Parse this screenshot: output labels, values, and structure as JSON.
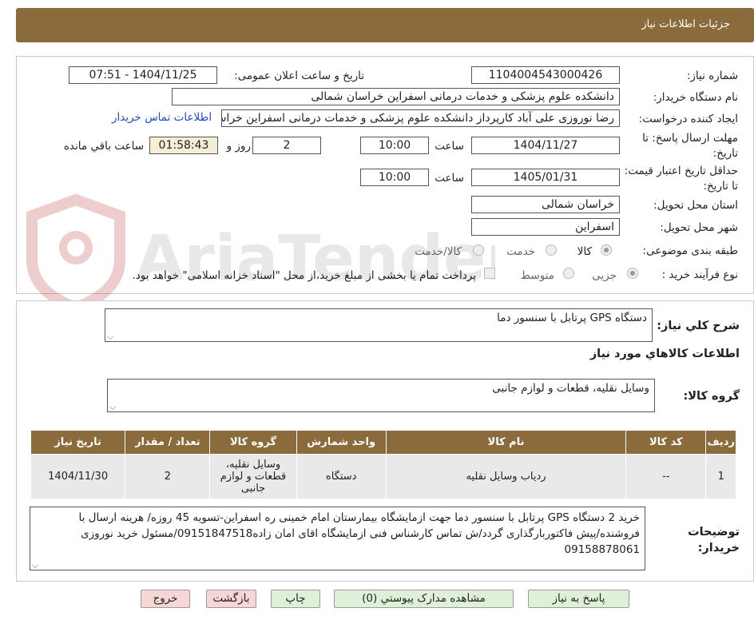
{
  "header": {
    "title": "جزئیات اطلاعات نیاز"
  },
  "form": {
    "need_number_label": "شماره نیاز:",
    "need_number": "1104004543000426",
    "announce_label": "تاریخ و ساعت اعلان عمومی:",
    "announce_value": "1404/11/25 - 07:51",
    "buyer_org_label": "نام دستگاه خریدار:",
    "buyer_org": "دانشکده علوم پزشکی و خدمات درمانی اسفراین خراسان شمالی",
    "requester_label": "ایجاد کننده درخواست:",
    "requester": "رضا نوروزی علی آباد کارپرداز  دانشکده علوم پزشکی و خدمات درمانی اسفراین خراسان شمالی",
    "contact_link": "اطلاعات تماس خریدار",
    "deadline_label": "مهلت ارسال پاسخ: تا تاریخ:",
    "deadline_date": "1404/11/27",
    "time_label": "ساعت",
    "deadline_time": "10:00",
    "days_value": "2",
    "days_label": "روز و",
    "remaining_time": "01:58:43",
    "remaining_label": "ساعت باقي مانده",
    "validity_label": "حداقل تاریخ اعتبار قیمت: تا تاریخ:",
    "validity_date": "1405/01/31",
    "validity_time": "10:00",
    "province_label": "استان محل تحویل:",
    "province": "خراسان شمالی",
    "city_label": "شهر محل تحویل:",
    "city": "اسفراین",
    "category_label": "طبقه بندی موضوعی:",
    "category_options": [
      "کالا",
      "خدمت",
      "کالا/خدمت"
    ],
    "process_label": "نوع فرآیند خرید :",
    "process_options": [
      "جزیی",
      "متوسط"
    ],
    "process_note": "پرداخت تمام یا بخشی از مبلغ خرید،از محل \"اسناد خزانه اسلامی\" خواهد بود."
  },
  "summary": {
    "label": "شرح کلي نياز:",
    "value": "دستگاه GPS پرتابل با سنسور دما",
    "items_heading": "اطلاعات کالاهاي مورد نياز",
    "group_label": "گروه کالا:",
    "group_value": "وسایل نقلیه، قطعات و لوازم جانبی"
  },
  "table": {
    "headers": [
      "رديف",
      "کد کالا",
      "نام کالا",
      "واحد شمارش",
      "گروه کالا",
      "تعداد / مقدار",
      "تاريخ نياز"
    ],
    "rows": [
      [
        "1",
        "--",
        "ردیاب وسایل نقلیه",
        "دستگاه",
        "وسایل نقلیه، قطعات و لوازم جانبی",
        "2",
        "1404/11/30"
      ]
    ]
  },
  "notes": {
    "label": "توضيحات خريدار:",
    "value": "خرید 2 دستگاه GPS پرتابل با سنسور دما جهت ازمایشگاه بیمارستان امام خمینی ره اسفراین-تسویه 45 روزه/ هرینه ارسال با فروشنده/پیش فاکتوربارگذاری گردد/ش تماس کارشناس فنی ازمایشگاه اقای امان زاده09151847518/مسئول خرید نوروزی 09158878061"
  },
  "buttons": {
    "reply": "پاسخ به نياز",
    "attachments": "مشاهده مدارک پيوستي (0)",
    "print": "چاپ",
    "back": "بازگشت",
    "exit": "خروج"
  },
  "watermark": "AriaTender.neT",
  "colors": {
    "header": "#8b6b3c",
    "button": "#dff0d8",
    "button_red": "#f7d6d6",
    "link": "#1b4fc4"
  }
}
